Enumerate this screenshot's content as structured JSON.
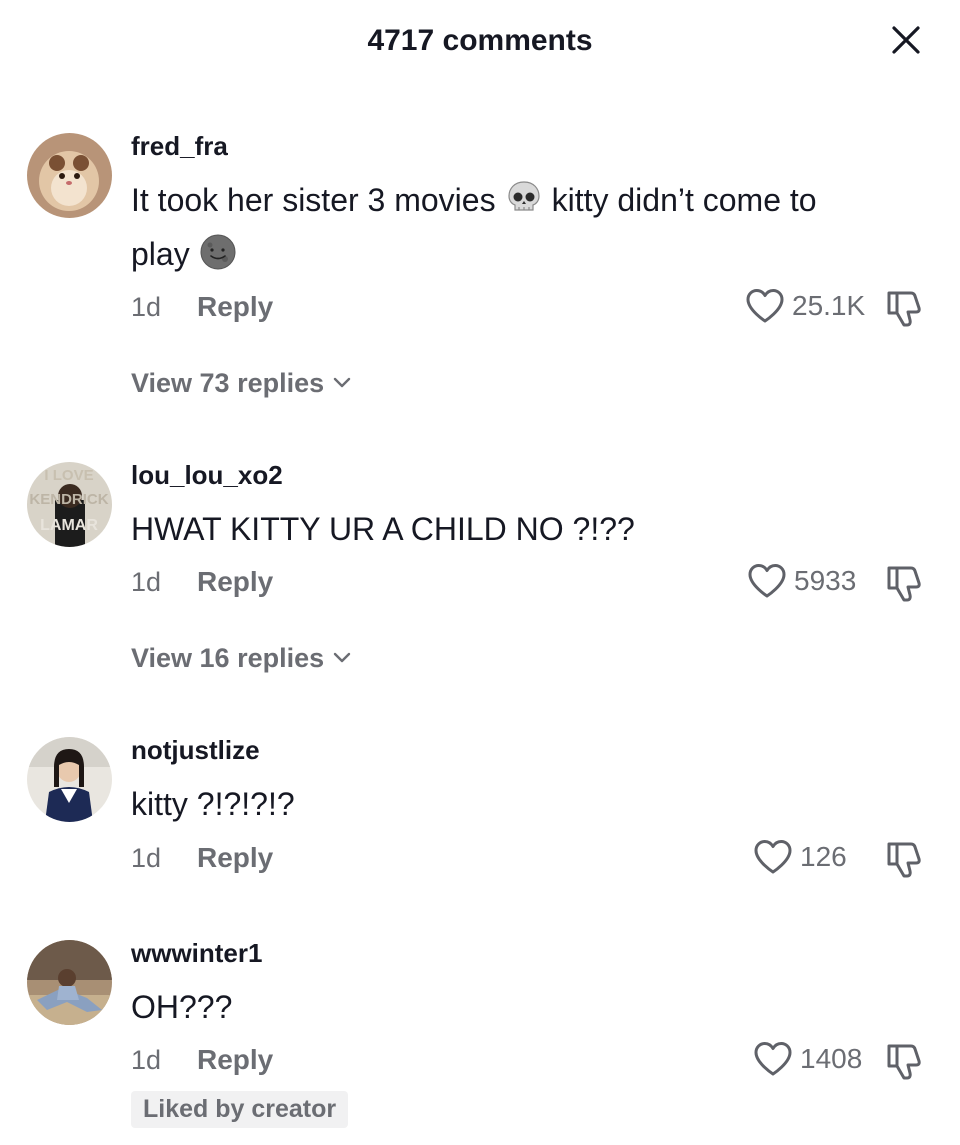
{
  "header": {
    "title": "4717 comments",
    "close_icon": "close-icon"
  },
  "comments": [
    {
      "username": "fred_fra",
      "text_part1": "It took her sister 3 movies",
      "emoji1": "skull-emoji",
      "text_part2": "kitty didn’t come to",
      "text_part3": "play",
      "emoji2": "new-moon-face-emoji",
      "time": "1d",
      "reply_label": "Reply",
      "likes": "25.1K",
      "view_replies": "View 73 replies"
    },
    {
      "username": "lou_lou_xo2",
      "avatar_text": [
        "I LOVE",
        "KENDRICK",
        "LAMAR"
      ],
      "text": "HWAT KITTY UR A CHILD NO ?!??",
      "time": "1d",
      "reply_label": "Reply",
      "likes": "5933",
      "view_replies": "View 16 replies"
    },
    {
      "username": "notjustlize",
      "text": "kitty ?!?!?!?",
      "time": "1d",
      "reply_label": "Reply",
      "likes": "126"
    },
    {
      "username": "wwwinter1",
      "text": "OH???",
      "time": "1d",
      "reply_label": "Reply",
      "likes": "1408",
      "badge": "Liked by creator"
    }
  ],
  "colors": {
    "text": "#161823",
    "muted": "#6b6d73",
    "badge_bg": "#f1f1f2"
  }
}
